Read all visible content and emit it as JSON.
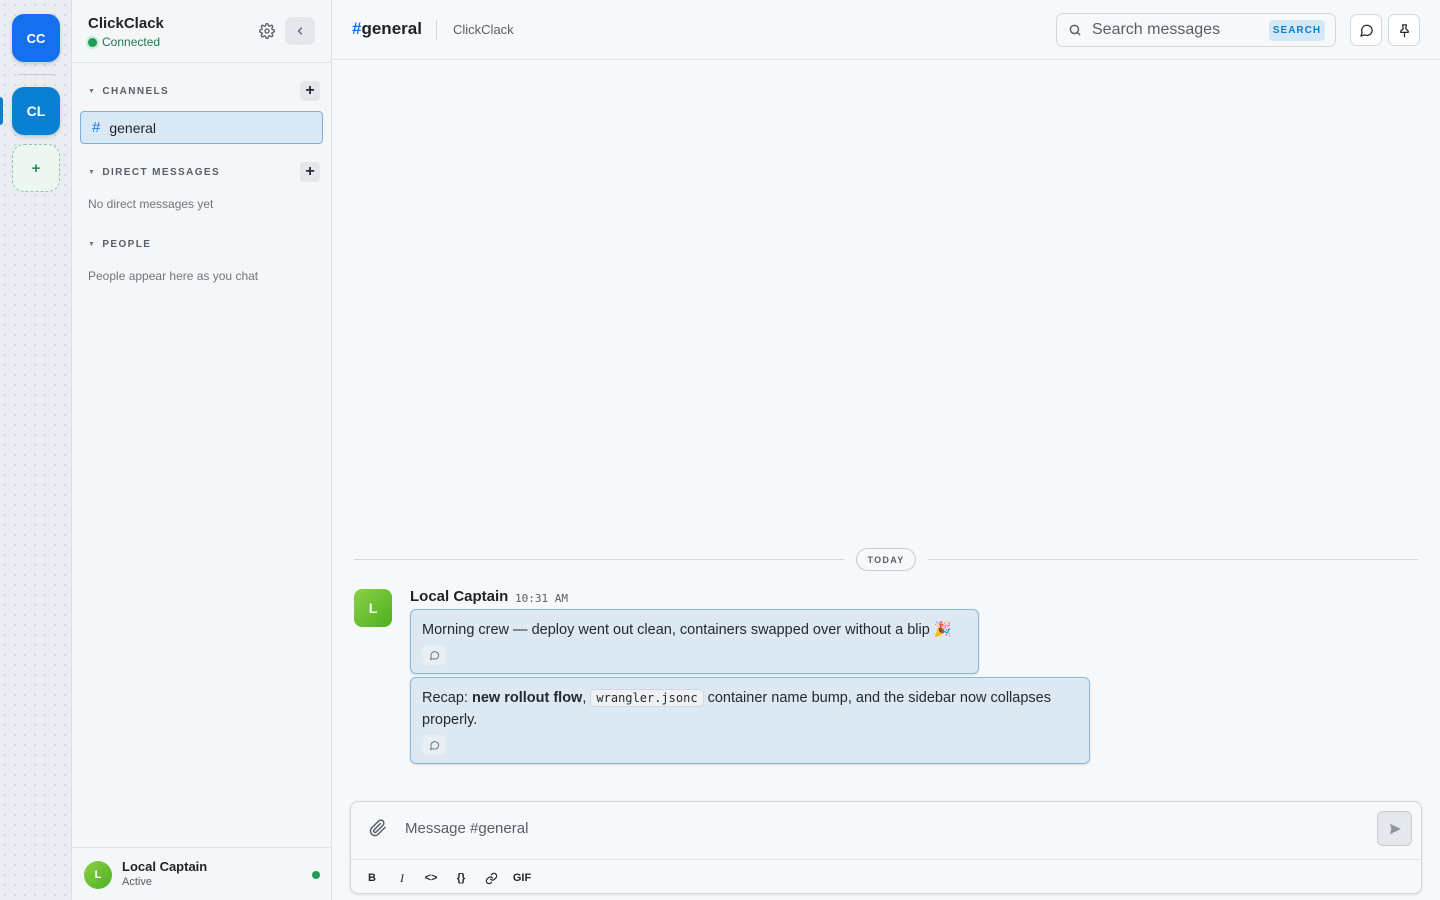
{
  "rail": {
    "workspaces": [
      {
        "initials": "CC",
        "color": "#1570ef"
      },
      {
        "initials": "CL",
        "color": "#0b7fd1",
        "active": true
      }
    ],
    "add_label": "+"
  },
  "sidebar": {
    "app_name": "ClickClack",
    "status": "Connected",
    "sections": {
      "channels": {
        "title": "CHANNELS",
        "items": [
          {
            "label": "general",
            "prefix": "#",
            "active": true
          }
        ]
      },
      "direct_messages": {
        "title": "DIRECT MESSAGES",
        "empty": "No direct messages yet"
      },
      "people": {
        "title": "PEOPLE",
        "empty": "People appear here as you chat"
      }
    },
    "add_label": "+",
    "footer": {
      "avatar": "L",
      "name": "Local Captain",
      "status": "Active"
    }
  },
  "header": {
    "channel_prefix": "#",
    "channel_name": "general",
    "workspace": "ClickClack",
    "search_placeholder": "Search messages",
    "search_button": "SEARCH"
  },
  "messages": {
    "date_divider": "TODAY",
    "author": "Local Captain",
    "avatar": "L",
    "time": "10:31 AM",
    "items": [
      {
        "text": "Morning crew — deploy went out clean, containers swapped over without a blip 🎉"
      },
      {
        "prefix": "Recap: ",
        "bold": "new rollout flow",
        "sep": ", ",
        "code": "wrangler.jsonc",
        "suffix": " container name bump, and the sidebar now collapses properly."
      }
    ]
  },
  "composer": {
    "placeholder": "Message #general",
    "format": {
      "bold": "B",
      "italic": "I",
      "inline_code": "<>",
      "code_block": "{}",
      "gif": "GIF"
    }
  },
  "colors": {
    "accent": "#1570ef",
    "online": "#1f9d55",
    "bubble": "#dce8f2"
  }
}
